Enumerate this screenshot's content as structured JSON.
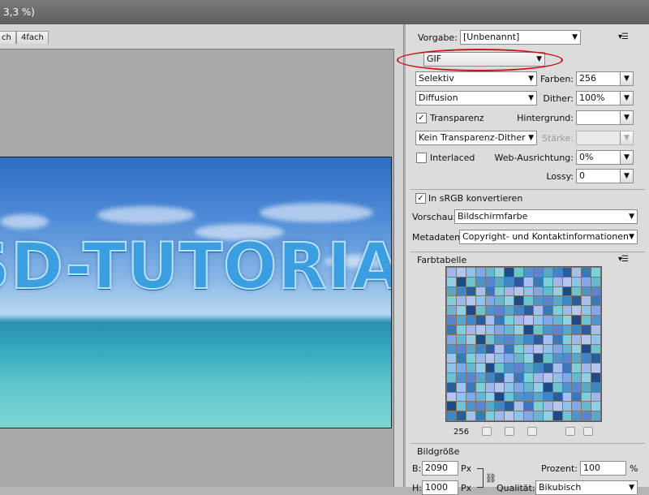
{
  "window": {
    "title_fragment": "3,3 %)"
  },
  "tabs": {
    "items": [
      "ch",
      "4fach"
    ]
  },
  "preview": {
    "image_text": "SD-TUTORIAL"
  },
  "settings": {
    "preset_label": "Vorgabe:",
    "preset_value": "[Unbenannt]",
    "format_value": "GIF",
    "reduction_value": "Selektiv",
    "colors_label": "Farben:",
    "colors_value": "256",
    "dither_algo_value": "Diffusion",
    "dither_label": "Dither:",
    "dither_value": "100%",
    "transparency_label": "Transparenz",
    "transparency_checked": true,
    "matte_label": "Hintergrund:",
    "matte_value": "",
    "transp_dither_value": "Kein Transparenz-Dither",
    "amount_label": "Stärke:",
    "amount_value": "",
    "interlaced_label": "Interlaced",
    "interlaced_checked": false,
    "web_snap_label": "Web-Ausrichtung:",
    "web_snap_value": "0%",
    "lossy_label": "Lossy:",
    "lossy_value": "0",
    "srgb_label": "In sRGB konvertieren",
    "srgb_checked": true,
    "preview_label": "Vorschau:",
    "preview_value": "Bildschirmfarbe",
    "metadata_label": "Metadaten:",
    "metadata_value": "Copyright- und Kontaktinformationen"
  },
  "color_table": {
    "title": "Farbtabelle",
    "count": "256",
    "palette": [
      "#9fb7e9",
      "#6fc3cf",
      "#3b78b8",
      "#93cfe3",
      "#2c5d9b",
      "#84a8e6",
      "#5ba7c7",
      "#b4c6f0",
      "#4f93c9",
      "#7dd0d8",
      "#1e4a86",
      "#a6c0ee",
      "#68b6cf",
      "#3f86c2",
      "#8ec4ea",
      "#5c84cf"
    ]
  },
  "image_size": {
    "title": "Bildgröße",
    "width_label": "B:",
    "width_value": "2090",
    "height_label": "H:",
    "height_value": "1000",
    "unit": "Px",
    "percent_label": "Prozent:",
    "percent_value": "100",
    "percent_unit": "%",
    "quality_label": "Qualität:",
    "quality_value": "Bikubisch"
  }
}
